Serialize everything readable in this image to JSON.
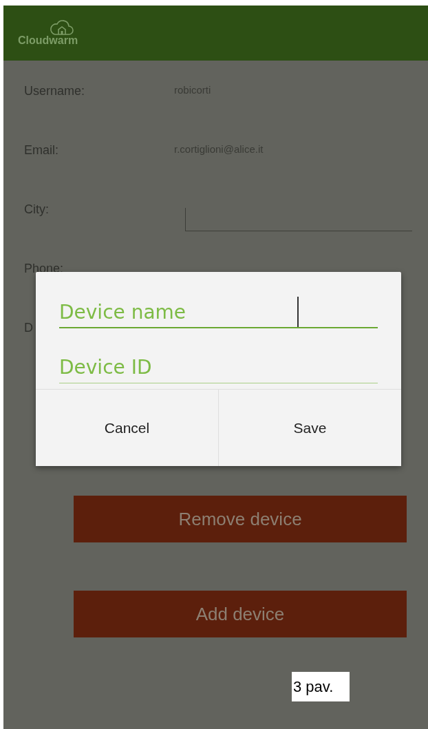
{
  "header": {
    "logo_text": "Cloudwarm"
  },
  "profile": [
    {
      "label": "Username:",
      "value": "robicorti",
      "kind": "text"
    },
    {
      "label": "Email:",
      "value": "r.cortiglioni@alice.it",
      "kind": "text"
    },
    {
      "label": "City:",
      "kind": "input"
    },
    {
      "label": "Phone:",
      "kind": "text"
    },
    {
      "label": "D",
      "kind": "text"
    }
  ],
  "dialog": {
    "fields": [
      {
        "placeholder": "Device name",
        "focused": true
      },
      {
        "placeholder": "Device ID",
        "focused": false
      }
    ],
    "buttons": [
      "Cancel",
      "Save"
    ]
  },
  "actions": [
    "Remove device",
    "Add device"
  ],
  "caption": "3 pav."
}
